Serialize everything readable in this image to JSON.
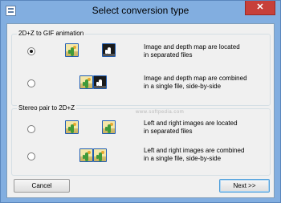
{
  "window": {
    "title": "Select conversion type",
    "close_label": "✕"
  },
  "groups": [
    {
      "title": "2D+Z to GIF animation",
      "options": [
        {
          "checked": true,
          "line1": "Image and depth map are located",
          "line2": "in separated files",
          "images": [
            "photo",
            "depth"
          ],
          "layout": "separated"
        },
        {
          "checked": false,
          "line1": "Image and depth map are combined",
          "line2": "in a single file, side-by-side",
          "images": [
            "photo",
            "depth"
          ],
          "layout": "combined"
        }
      ]
    },
    {
      "title": "Stereo pair to 2D+Z",
      "options": [
        {
          "checked": false,
          "line1": "Left and right images are located",
          "line2": "in separated files",
          "images": [
            "photo",
            "photo"
          ],
          "layout": "separated"
        },
        {
          "checked": false,
          "line1": "Left and right images are combined",
          "line2": "in a single file, side-by-side",
          "images": [
            "photo",
            "photo"
          ],
          "layout": "combined"
        }
      ]
    }
  ],
  "watermark": "www.softpedia.com",
  "buttons": {
    "cancel": "Cancel",
    "next": "Next >>"
  }
}
